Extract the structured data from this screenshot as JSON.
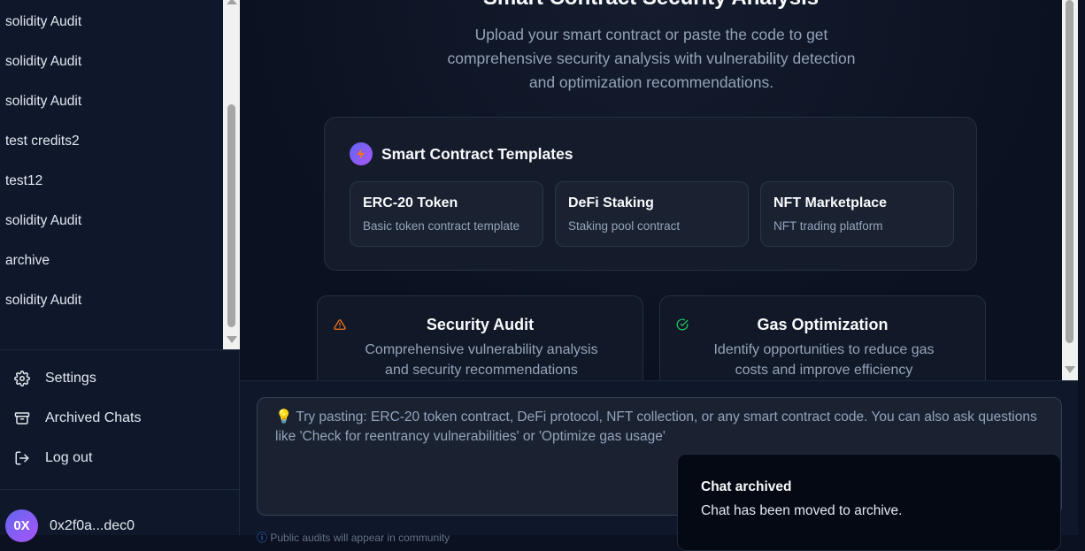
{
  "sidebar": {
    "chats": [
      "solidity Audit",
      "solidity Audit",
      "solidity Audit",
      "test credits2",
      "test12",
      "solidity Audit",
      "archive",
      "solidity Audit"
    ],
    "menu": {
      "settings": "Settings",
      "archived": "Archived Chats",
      "logout": "Log out"
    },
    "user": {
      "avatar": "0X",
      "address": "0x2f0a...dec0"
    }
  },
  "main": {
    "title": "Smart Contract Security Analysis",
    "description": "Upload your smart contract or paste the code to get comprehensive security analysis with vulnerability detection and optimization recommendations.",
    "templates": {
      "title": "Smart Contract Templates",
      "items": [
        {
          "name": "ERC-20 Token",
          "desc": "Basic token contract template"
        },
        {
          "name": "DeFi Staking",
          "desc": "Staking pool contract"
        },
        {
          "name": "NFT Marketplace",
          "desc": "NFT trading platform"
        }
      ]
    },
    "features": [
      {
        "title": "Security Audit",
        "desc": "Comprehensive vulnerability analysis and security recommendations"
      },
      {
        "title": "Gas Optimization",
        "desc": "Identify opportunities to reduce gas costs and improve efficiency"
      }
    ]
  },
  "input": {
    "placeholder": "💡 Try pasting: ERC-20 token contract, DeFi protocol, NFT collection, or any smart contract code. You can also ask questions like 'Check for reentrancy vulnerabilities' or 'Optimize gas usage'",
    "hint": "Public audits will appear in community"
  },
  "toast": {
    "title": "Chat archived",
    "message": "Chat has been moved to archive."
  },
  "colors": {
    "accent_start": "#6366f1",
    "accent_end": "#a855f7",
    "warning": "#f97316",
    "success": "#22c55e"
  }
}
